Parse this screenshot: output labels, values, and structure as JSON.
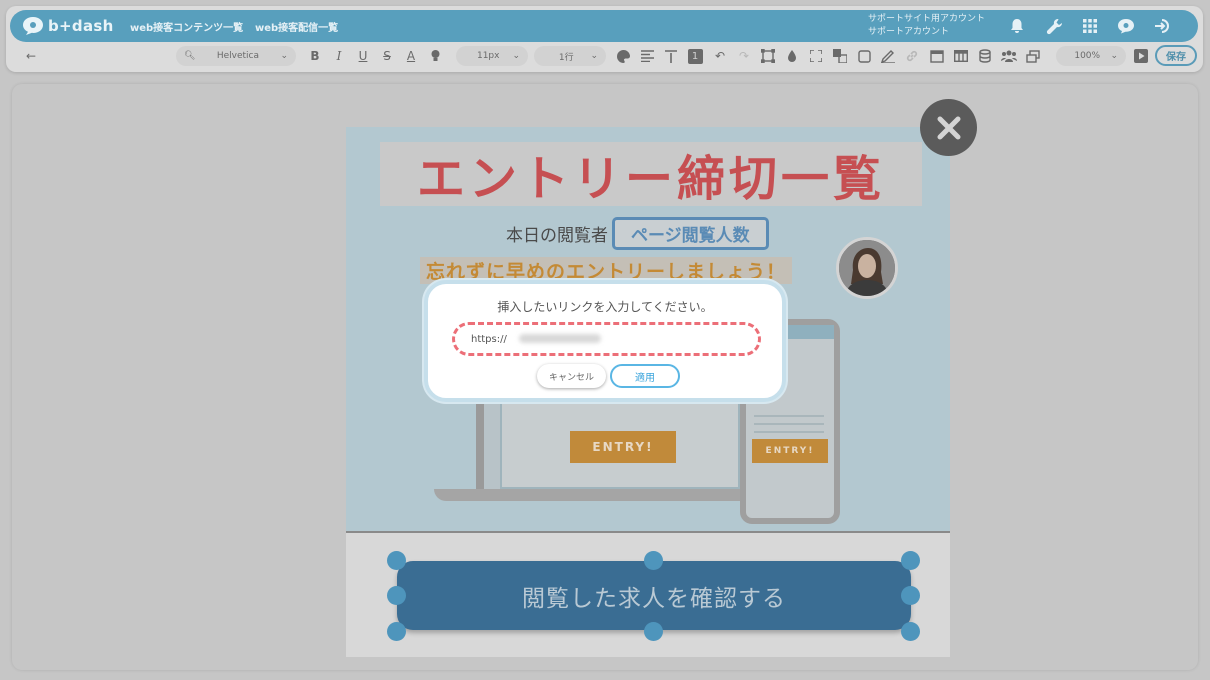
{
  "app": {
    "logo_text": "b+dash",
    "nav": [
      "web接客コンテンツ一覧",
      "web接客配信一覧"
    ],
    "account_line1": "サポートサイト用アカウント",
    "account_line2": "サポートアカウント"
  },
  "toolbar": {
    "back_icon": "back-arrow-icon",
    "font": "Helvetica",
    "font_size": "11px",
    "line_height": "1行",
    "badge_number": "1",
    "zoom": "100%",
    "save_label": "保存"
  },
  "preview": {
    "title": "エントリー締切一覧",
    "viewers_label": "本日の閲覧者",
    "viewers_box": "ページ閲覧人数",
    "reminder": "忘れずに早めのエントリーしましょう！",
    "entry_label": "ENTRY!",
    "cta_label": "閲覧した求人を確認する"
  },
  "dialog": {
    "message": "挿入したいリンクを入力してください。",
    "url_value": "https://",
    "cancel_label": "キャンセル",
    "apply_label": "適用"
  },
  "colors": {
    "topbar": "#589fbd",
    "title_red": "#c64f52",
    "cta_blue": "#3a6d93",
    "dashed_highlight": "#ec6f78",
    "apply_blue": "#5ab6e4"
  }
}
